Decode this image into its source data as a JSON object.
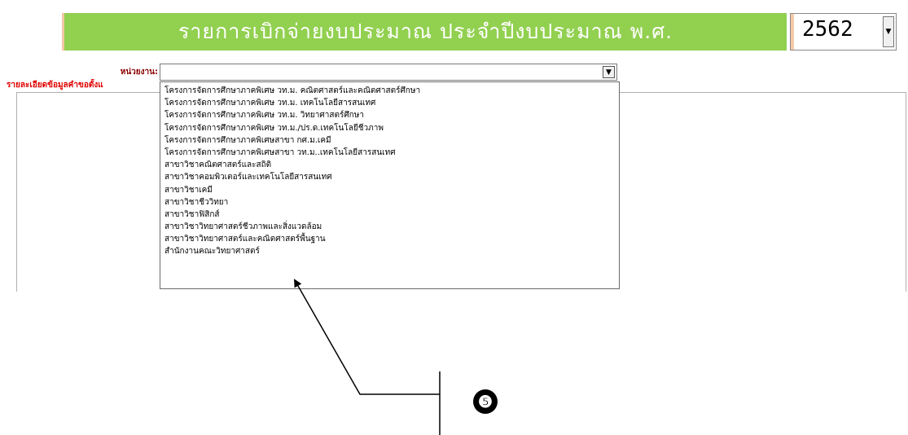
{
  "header": {
    "title": "รายการเบิกจ่ายงบประมาณ ประจำปีงบประมาณ พ.ศ.",
    "year_value": "2562"
  },
  "form": {
    "unit_label": "หน่วยงาน:",
    "unit_value": "",
    "detail_label": "รายละเอียดข้อมูลคำขอตั้งแ"
  },
  "dropdown": {
    "options": [
      "โครงการจัดการศึกษาภาคพิเศษ วท.ม. คณิตศาสตร์และคณิตศาสตร์ศึกษา",
      "โครงการจัดการศึกษาภาคพิเศษ วท.ม. เทคโนโลยีสารสนเทศ",
      "โครงการจัดการศึกษาภาคพิเศษ วท.ม. วิทยาศาสตร์ศึกษา",
      "โครงการจัดการศึกษาภาคพิเศษ วท.ม./ปร.ด.เทคโนโลยีชีวภาพ",
      "โครงการจัดการศึกษาภาคพิเศษสาขา กศ.ม.เคมี",
      "โครงการจัดการศึกษาภาคพิเศษสาขา วท.ม..เทคโนโลยีสารสนเทศ",
      "สาขาวิชาคณิตศาสตร์และสถิติ",
      "สาขาวิชาคอมพิวเตอร์และเทคโนโลยีสารสนเทศ",
      "สาขาวิชาเคมี",
      "สาขาวิชาชีววิทยา",
      "สาขาวิชาฟิสิกส์",
      "สาขาวิชาวิทยาศาสตร์ชีวภาพและสิ่งแวดล้อม",
      "สาขาวิชาวิทยาศาสตร์และคณิตศาสตร์พื้นฐาน",
      "สำนักงานคณะวิทยาศาสตร์"
    ]
  },
  "annotation": {
    "callout_number": "❺"
  },
  "colors": {
    "title_bg": "#92d050",
    "unit_label": "#8b0000",
    "detail_label": "#e00000"
  }
}
